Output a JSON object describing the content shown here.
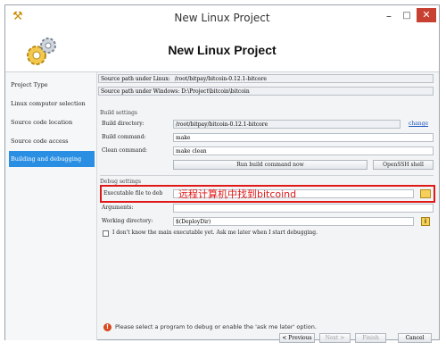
{
  "window": {
    "title": "New Linux Project"
  },
  "header": {
    "title": "New Linux Project"
  },
  "sidebar": {
    "items": [
      {
        "label": "Project Type"
      },
      {
        "label": "Linux computer selection"
      },
      {
        "label": "Source code location"
      },
      {
        "label": "Source code access"
      },
      {
        "label": "Building and debugging",
        "active": true
      }
    ]
  },
  "paths": {
    "linux_label": "Source path under Linux:",
    "linux_value": "/root/bitpay/bitcoin-0.12.1-bitcore",
    "windows_label": "Source path under Windows:",
    "windows_value": "D:\\Project\\bitcoin\\bitcoin"
  },
  "build": {
    "section_label": "Build settings",
    "dir_label": "Build directory:",
    "dir_value": "/root/bitpay/bitcoin-0.12.1-bitcore",
    "change_link": "change",
    "build_cmd_label": "Build command:",
    "build_cmd_value": "make",
    "clean_cmd_label": "Clean command:",
    "clean_cmd_value": "make clean",
    "run_button": "Run build command now",
    "openssh_button": "OpenSSH shell"
  },
  "debug": {
    "section_label": "Debug settings",
    "exe_label": "Executable file to deb",
    "exe_value": "",
    "annotation": "远程计算机中找到bitcoind",
    "args_label": "Arguments:",
    "args_value": "",
    "workdir_label": "Working directory:",
    "workdir_value": "$(DeployDir)",
    "checkbox_label": "I don't know the main executable yet. Ask me later when I start debugging."
  },
  "footer": {
    "status": "Please select a program to debug or enable the 'ask me later' option.",
    "prev": "< Previous",
    "next": "Next >",
    "finish": "Finish",
    "cancel": "Cancel"
  },
  "colors": {
    "accent": "#2a8ee2",
    "annotation": "#e11818",
    "close": "#c84031"
  }
}
